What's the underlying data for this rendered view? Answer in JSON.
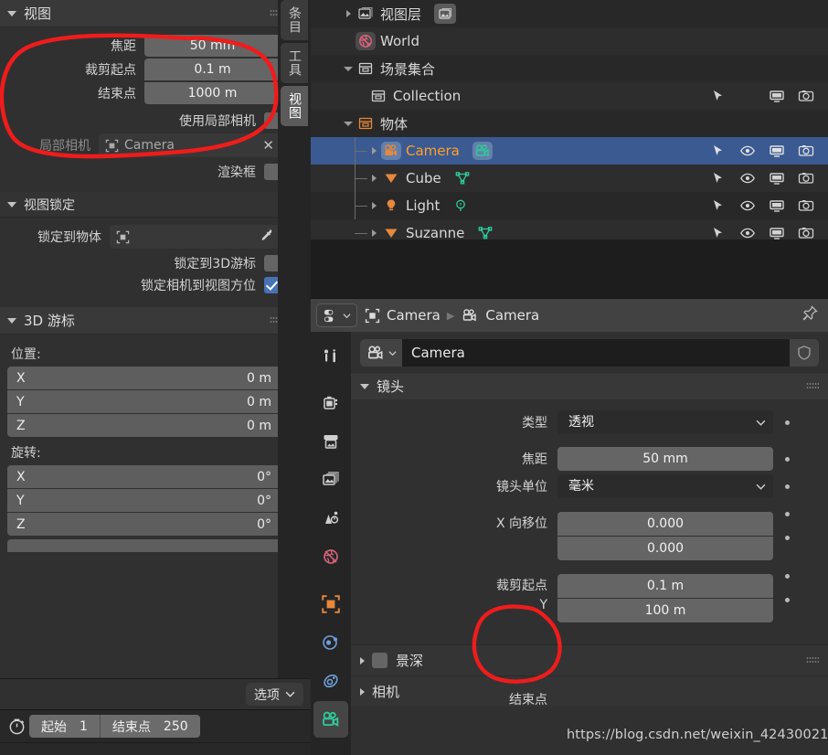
{
  "sidebar": {
    "view_panel": {
      "title": "视图",
      "focal_label": "焦距",
      "focal_value": "50 mm",
      "clip_start_label": "裁剪起点",
      "clip_start_value": "0.1 m",
      "clip_end_label": "结束点",
      "clip_end_value": "1000 m",
      "use_local_camera_label": "使用局部相机",
      "local_camera_label": "局部相机",
      "local_camera_value": "Camera",
      "render_border_label": "渲染框"
    },
    "view_lock_panel": {
      "title": "视图锁定",
      "lock_object_label": "锁定到物体",
      "lock_object_value": "",
      "lock_cursor_label": "锁定到3D游标",
      "lock_camera_label": "锁定相机到视图方位"
    },
    "cursor_panel": {
      "title": "3D 游标",
      "location_label": "位置:",
      "rotation_label": "旋转:",
      "location": [
        {
          "axis": "X",
          "value": "0 m"
        },
        {
          "axis": "Y",
          "value": "0 m"
        },
        {
          "axis": "Z",
          "value": "0 m"
        }
      ],
      "rotation": [
        {
          "axis": "X",
          "value": "0°"
        },
        {
          "axis": "Y",
          "value": "0°"
        },
        {
          "axis": "Z",
          "value": "0°"
        }
      ]
    },
    "tabs": [
      {
        "label": "条目",
        "active": false
      },
      {
        "label": "工具",
        "active": false
      },
      {
        "label": "视图",
        "active": true
      }
    ]
  },
  "outliner": {
    "rows": [
      {
        "name": "视图层",
        "type": "viewlayer",
        "indent": 0,
        "expander": "right",
        "icon": "viewlayer-icon",
        "data_icon": "viewlayer-icon",
        "selected": false,
        "controls": false
      },
      {
        "name": "World",
        "type": "world",
        "indent": 1,
        "expander": "none",
        "icon": "world-icon",
        "data_icon": "",
        "selected": false,
        "controls": false
      },
      {
        "name": "场景集合",
        "type": "collection",
        "indent": 0,
        "expander": "down",
        "icon": "collection-icon",
        "data_icon": "",
        "selected": false,
        "controls": false
      },
      {
        "name": "Collection",
        "type": "collection",
        "indent": 2,
        "expander": "none",
        "icon": "collection-icon",
        "data_icon": "",
        "selected": false,
        "controls": true,
        "eye": false
      },
      {
        "name": "物体",
        "type": "group",
        "indent": 0,
        "expander": "down",
        "icon": "objects-icon",
        "data_icon": "",
        "selected": false,
        "controls": false
      },
      {
        "name": "Camera",
        "type": "camera",
        "indent": 2,
        "expander": "right",
        "icon": "camera-object-icon",
        "data_icon": "camera-data-icon",
        "selected": true,
        "controls": true,
        "eye": true
      },
      {
        "name": "Cube",
        "type": "mesh",
        "indent": 2,
        "expander": "right",
        "icon": "mesh-object-icon",
        "data_icon": "mesh-data-icon",
        "selected": false,
        "controls": true,
        "eye": true
      },
      {
        "name": "Light",
        "type": "light",
        "indent": 2,
        "expander": "right",
        "icon": "light-object-icon",
        "data_icon": "light-data-icon",
        "selected": false,
        "controls": true,
        "eye": true
      },
      {
        "name": "Suzanne",
        "type": "mesh",
        "indent": 2,
        "expander": "right",
        "icon": "mesh-object-icon",
        "data_icon": "mesh-data-icon",
        "selected": false,
        "controls": true,
        "eye": true
      }
    ]
  },
  "properties": {
    "breadcrumb": {
      "object": "Camera",
      "data": "Camera"
    },
    "id_name": "Camera",
    "tabs": [
      {
        "name": "tool",
        "active": false
      },
      {
        "name": "render",
        "active": false
      },
      {
        "name": "output",
        "active": false
      },
      {
        "name": "view-layer",
        "active": false
      },
      {
        "name": "scene",
        "active": false
      },
      {
        "name": "world",
        "active": false
      },
      {
        "name": "object",
        "active": false
      },
      {
        "name": "physics",
        "active": false
      },
      {
        "name": "constraints",
        "active": false
      },
      {
        "name": "camera-data",
        "active": true
      }
    ],
    "lens_panel": {
      "title": "镜头",
      "rows": [
        {
          "label": "类型",
          "value": "透视",
          "kind": "dropdown"
        },
        {
          "label": "焦距",
          "value": "50 mm",
          "kind": "number"
        },
        {
          "label": "镜头单位",
          "value": "毫米",
          "kind": "dropdown"
        },
        {
          "label": "X 向移位",
          "value": "0.000",
          "kind": "number"
        },
        {
          "label": "Y",
          "value": "0.000",
          "kind": "number"
        },
        {
          "label": "裁剪起点",
          "value": "0.1 m",
          "kind": "number"
        },
        {
          "label": "结束点",
          "value": "100 m",
          "kind": "number"
        }
      ]
    },
    "collapsed_panels": [
      {
        "title": "景深",
        "checkbox": true
      },
      {
        "title": "相机",
        "checkbox": false
      }
    ]
  },
  "bottom": {
    "options_label": "选项",
    "start_label": "起始",
    "start_value": "1",
    "end_label": "结束点",
    "end_value": "250"
  },
  "watermark": "https://blog.csdn.net/weixin_42430021",
  "colors": {
    "accent_blue": "#3b5a91",
    "selected_text": "#ffa028",
    "annotation_red": "#ef1c1c",
    "checkbox_on": "#4772b3",
    "object_orange": "#e8883b",
    "data_green": "#2fc99a"
  }
}
